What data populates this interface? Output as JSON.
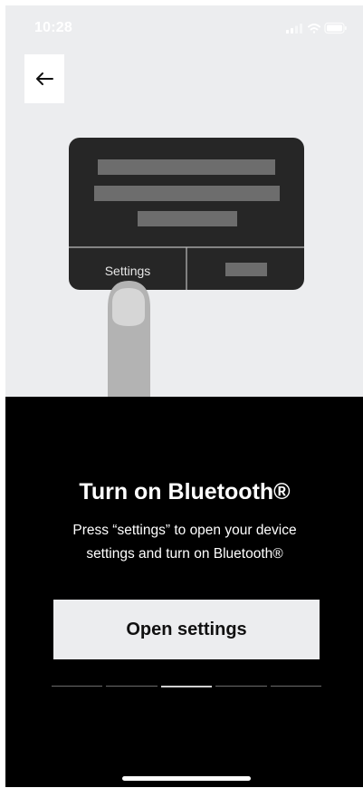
{
  "status_bar": {
    "time": "10:28"
  },
  "illustration": {
    "screen_button_label": "Settings"
  },
  "content": {
    "title": "Turn on Bluetooth®",
    "description": "Press “settings” to open your device settings and turn on Bluetooth®",
    "primary_button": "Open settings"
  },
  "pager": {
    "pages": 5,
    "active": 2
  }
}
